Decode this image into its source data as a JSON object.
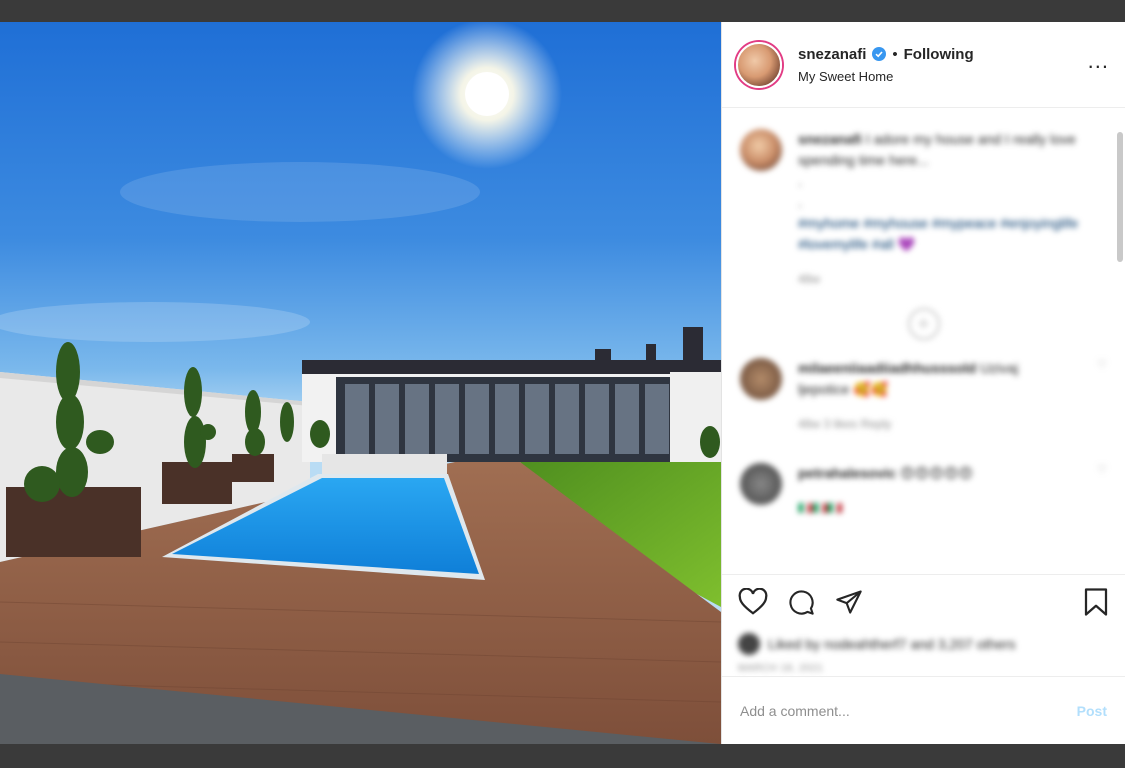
{
  "post": {
    "username": "snezanafi",
    "verified": true,
    "follow_status": "Following",
    "location": "My Sweet Home",
    "more_icon": "more-horizontal-icon"
  },
  "caption": {
    "author": "snezanafi",
    "text": "I adore my house and I really love spending time here...",
    "hashtags": "#myhome #myhouse #mypeace #enjoyinglife #lovemylife #all 💜",
    "time": "48w"
  },
  "comments": [
    {
      "author": "milaeeniiaadiiadhhusssold",
      "text": "Uzivaj ljepotice 🥰🥰",
      "meta": "48w   3 likes   Reply"
    },
    {
      "author": "petrahalesovic",
      "text": "😍😍😍😍😍",
      "meta": "🇮🇹🇮🇹🇮🇹"
    }
  ],
  "engagement": {
    "likes_text": "Liked by nodeahtherf7 and 3,207 others",
    "date": "MARCH 18, 2021"
  },
  "comment_box": {
    "placeholder": "Add a comment...",
    "post_label": "Post"
  },
  "colors": {
    "accent": "#0095f6",
    "post_disabled": "#b2dffc",
    "text": "#262626",
    "muted": "#8e8e8e"
  }
}
